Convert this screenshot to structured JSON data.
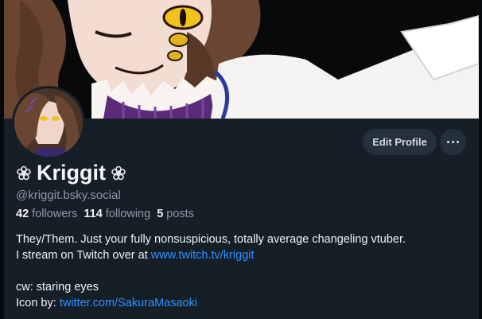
{
  "profile": {
    "display_name": "Kriggit",
    "handle": "@kriggit.bsky.social",
    "stats": [
      {
        "count": "42",
        "label": "followers"
      },
      {
        "count": "114",
        "label": "following"
      },
      {
        "count": "5",
        "label": "posts"
      }
    ],
    "bio": {
      "line1": "They/Them. Just your fully nonsuspicious, totally average changeling vtuber.",
      "line2_text": "I stream on Twitch over at ",
      "line2_link": "www.twitch.tv/kriggit",
      "line3": "cw: staring eyes",
      "line4_text": "Icon by: ",
      "line4_link": "twitter.com/SakuraMasaoki"
    }
  },
  "actions": {
    "edit_label": "Edit Profile"
  },
  "icons": {
    "name_prefix": "flower-icon",
    "name_suffix": "flower-icon",
    "more": "ellipsis-icon"
  },
  "colors": {
    "background": "#161e27",
    "button": "#25303d",
    "link": "#2f90ff",
    "muted": "#8d9aa8"
  }
}
